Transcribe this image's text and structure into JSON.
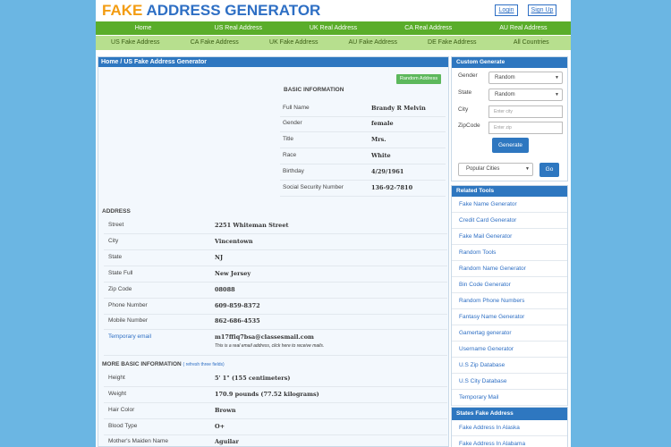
{
  "header": {
    "logo_part1": "FAKE",
    "logo_part2": "ADDRESS GENERATOR",
    "login": "Login",
    "signup": "Sign Up"
  },
  "nav_primary": [
    "Home",
    "US Real Address",
    "UK Real Address",
    "CA Real Address",
    "AU Real Address"
  ],
  "nav_secondary": [
    "US Fake Address",
    "CA Fake Address",
    "UK Fake Address",
    "AU Fake Address",
    "DE Fake Address",
    "All Countries"
  ],
  "breadcrumb": {
    "home": "Home",
    "separator": "/",
    "current": "US Fake Address Generator"
  },
  "random_button": "Random Address",
  "basic": {
    "title": "BASIC INFORMATION",
    "rows": [
      {
        "label": "Full Name",
        "value": "Brandy R Melvin"
      },
      {
        "label": "Gender",
        "value": "female"
      },
      {
        "label": "Title",
        "value": "Mrs."
      },
      {
        "label": "Race",
        "value": "White"
      },
      {
        "label": "Birthday",
        "value": "4/29/1961"
      },
      {
        "label": "Social Security Number",
        "value": "136-92-7810"
      }
    ]
  },
  "address": {
    "title": "ADDRESS",
    "rows": [
      {
        "label": "Street",
        "value": "2251  Whiteman Street"
      },
      {
        "label": "City",
        "value": "Vincentown"
      },
      {
        "label": "State",
        "value": "NJ"
      },
      {
        "label": "State Full",
        "value": "New Jersey"
      },
      {
        "label": "Zip Code",
        "value": "08088"
      },
      {
        "label": "Phone Number",
        "value": "609-859-8372"
      },
      {
        "label": "Mobile Number",
        "value": "862-686-4535"
      }
    ],
    "temp_email_label": "Temporary email",
    "temp_email_value": "m17ffiq7bsa@classesmail.com",
    "temp_email_note": "This is a real email address, click here to receive mails."
  },
  "more_basic": {
    "title": "MORE BASIC INFORMATION",
    "refresh": "( refresh three fields)",
    "rows": [
      {
        "label": "Height",
        "value": "5' 1\" (155 centimeters)"
      },
      {
        "label": "Weight",
        "value": "170.9 pounds (77.52 kilograms)"
      },
      {
        "label": "Hair Color",
        "value": "Brown"
      },
      {
        "label": "Blood Type",
        "value": "O+"
      },
      {
        "label": "Mother's Maiden Name",
        "value": "Aguilar"
      }
    ]
  },
  "custom_generate": {
    "title": "Custom Generate",
    "gender_label": "Gender",
    "gender_value": "Random",
    "state_label": "State",
    "state_value": "Random",
    "city_label": "City",
    "city_placeholder": "Enter city",
    "zip_label": "ZipCode",
    "zip_placeholder": "Enter zip",
    "generate": "Generate",
    "popular_cities": "Popular Cities",
    "go": "Go"
  },
  "related_tools": {
    "title": "Related Tools",
    "items": [
      "Fake Name Generator",
      "Credit Card Generator",
      "Fake Mail Generator",
      "Random Tools",
      "Random Name Generator",
      "Bin Code Generator",
      "Random Phone Numbers",
      "Fantasy Name Generator",
      "Gamertag generator",
      "Username Generator",
      "U.S Zip Database",
      "U.S City Database",
      "Temporary Mail"
    ]
  },
  "states_fake": {
    "title": "States Fake Address",
    "items": [
      "Fake Address In Alaska",
      "Fake Address In Alabama"
    ]
  },
  "colors": {
    "background": "#6bb6e3",
    "logo_orange": "#f39c12",
    "logo_blue": "#2e6fc4",
    "nav_green": "#5aad2a",
    "subnav_green": "#b7df8e",
    "panel_blue": "#2e77c0",
    "button_green": "#5cb85c"
  }
}
